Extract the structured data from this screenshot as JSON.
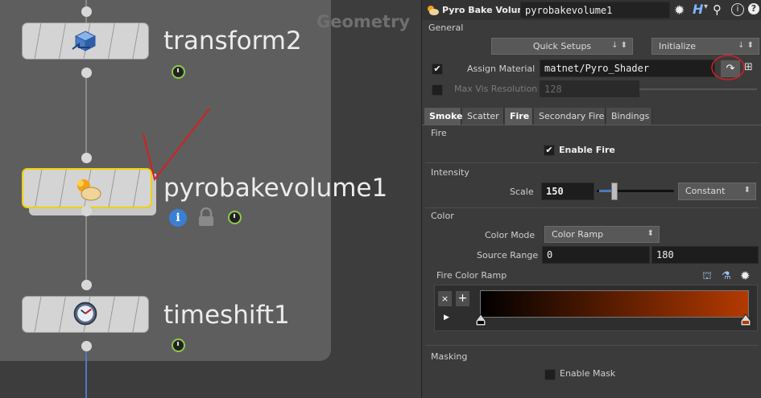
{
  "network": {
    "context_label": "Geometry",
    "nodes": [
      {
        "name": "transform2"
      },
      {
        "name": "pyrobakevolume1"
      },
      {
        "name": "timeshift1"
      }
    ]
  },
  "params": {
    "node_type": "Pyro Bake Volume",
    "node_name": "pyrobakevolume1",
    "header_icons": [
      "gear-icon",
      "help-h-icon",
      "search-icon",
      "info-icon",
      "help-icon"
    ],
    "general": {
      "title": "General",
      "quick_setups": "Quick Setups",
      "initialize": "Initialize",
      "assign_material_label": "Assign Material",
      "assign_material_value": "matnet/Pyro_Shader",
      "assign_material_checked": true,
      "max_vis_label": "Max Vis Resolution",
      "max_vis_value": "128",
      "max_vis_checked": false
    },
    "tabs": [
      "Smoke",
      "Scatter",
      "Fire",
      "Secondary Fire",
      "Bindings"
    ],
    "active_tab": "Fire",
    "fire": {
      "title": "Fire",
      "enable_fire_label": "Enable Fire",
      "enable_fire_checked": true
    },
    "intensity": {
      "title": "Intensity",
      "scale_label": "Scale",
      "scale_value": "150",
      "scale_mode": "Constant"
    },
    "color": {
      "title": "Color",
      "color_mode_label": "Color Mode",
      "color_mode_value": "Color Ramp",
      "source_range_label": "Source Range",
      "source_range_min": "0",
      "source_range_max": "180",
      "ramp_label": "Fire Color Ramp",
      "ramp_start_color": "#000000",
      "ramp_end_color": "#b43a00"
    },
    "masking": {
      "title": "Masking",
      "enable_mask_label": "Enable Mask",
      "enable_mask_checked": false
    }
  },
  "colors": {
    "annotation_red": "#d42020",
    "selected_node_border": "#f0d000",
    "clock_green": "#8fc94a",
    "info_blue": "#3a7fd6"
  }
}
